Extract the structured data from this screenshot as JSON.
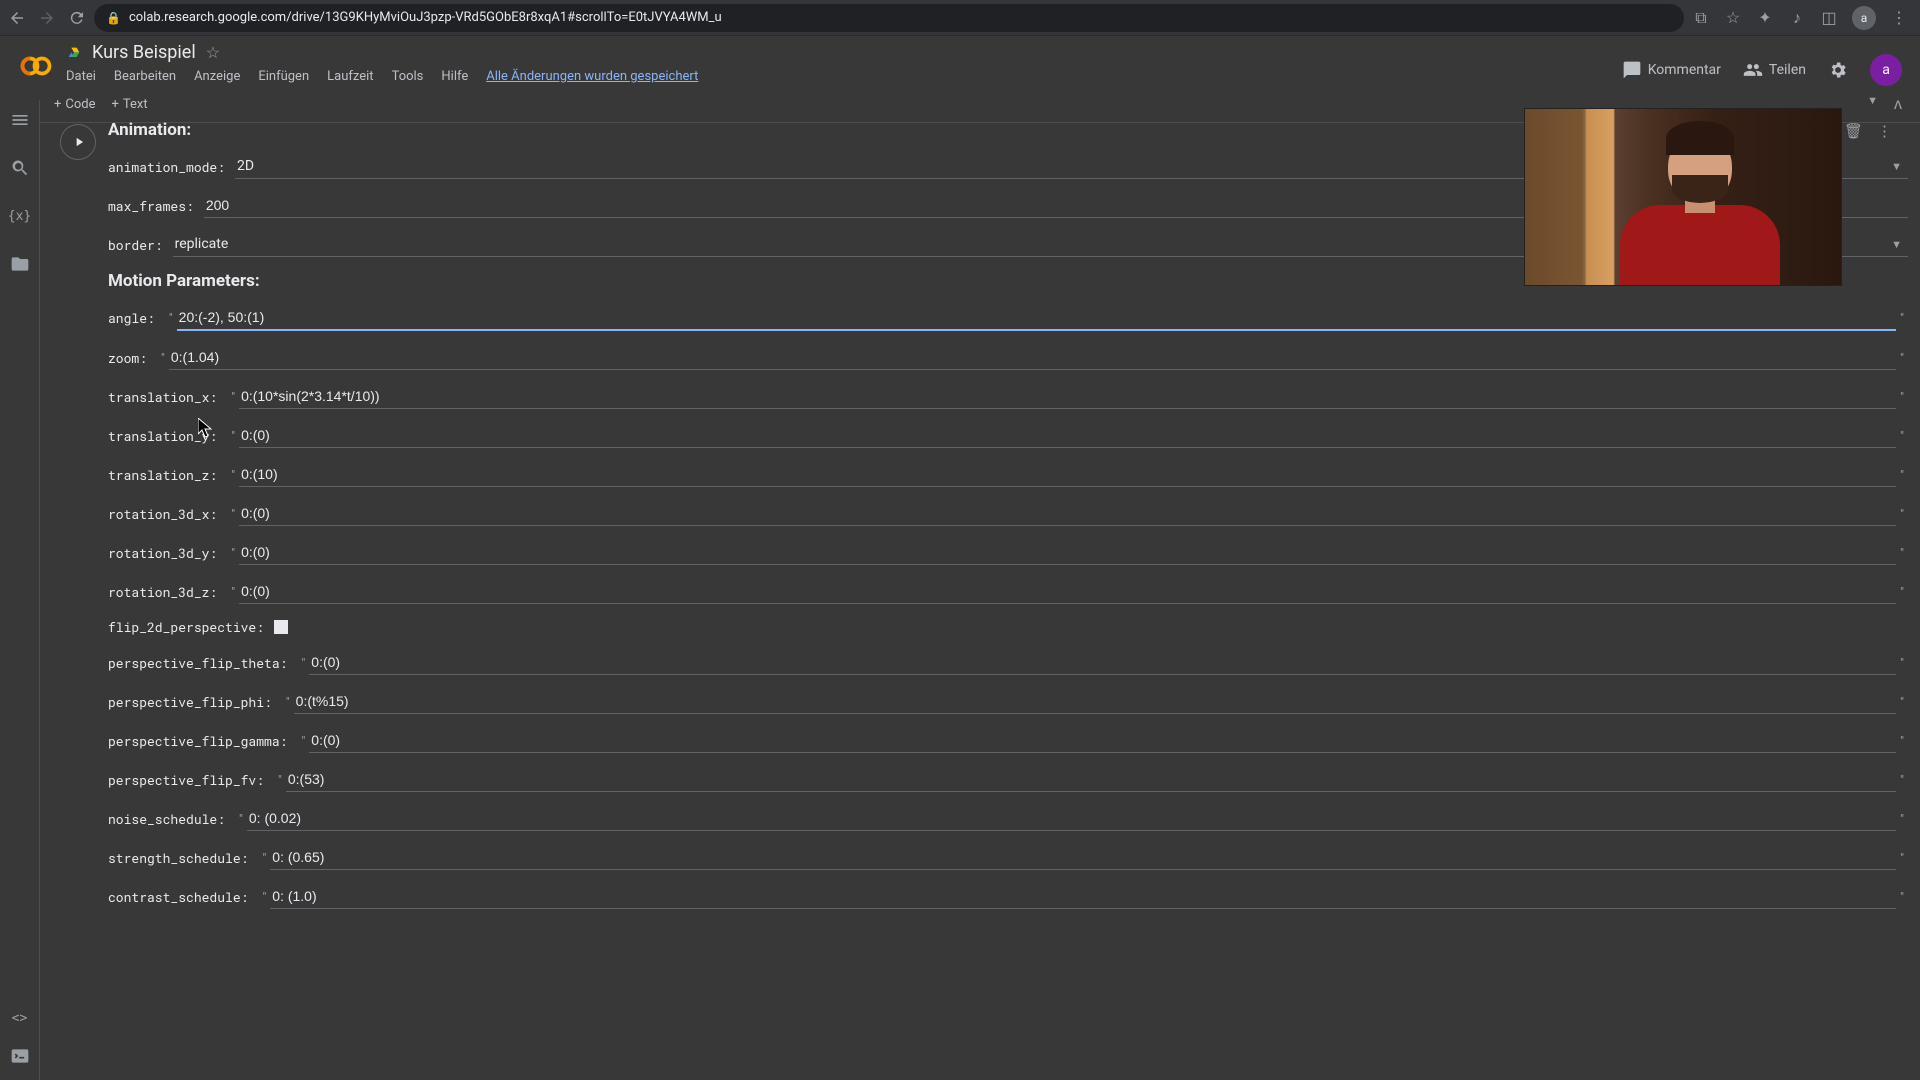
{
  "browser": {
    "url": "colab.research.google.com/drive/13G9KHyMviOuJ3pzp-VRd5GObE8r8xqA1#scrollTo=E0tJVYA4WM_u",
    "avatar_letter": "a"
  },
  "header": {
    "title": "Kurs Beispiel",
    "menu": [
      "Datei",
      "Bearbeiten",
      "Anzeige",
      "Einfügen",
      "Laufzeit",
      "Tools",
      "Hilfe"
    ],
    "save_status": "Alle Änderungen wurden gespeichert",
    "comment_label": "Kommentar",
    "share_label": "Teilen",
    "avatar_letter": "a"
  },
  "toolbar": {
    "code_label": "Code",
    "text_label": "Text"
  },
  "cell": {
    "sections": {
      "animation": "Animation:",
      "motion": "Motion Parameters:"
    },
    "fields": {
      "animation_mode": {
        "label": "animation_mode:",
        "value": "2D",
        "type": "select"
      },
      "max_frames": {
        "label": "max_frames:",
        "value": "200",
        "type": "text_plain"
      },
      "border": {
        "label": "border:",
        "value": "replicate",
        "type": "select"
      },
      "angle": {
        "label": "angle:",
        "value": "20:(-2), 50:(1)",
        "type": "text",
        "active": true
      },
      "zoom": {
        "label": "zoom:",
        "value": "0:(1.04)",
        "type": "text"
      },
      "translation_x": {
        "label": "translation_x:",
        "value": "0:(10*sin(2*3.14*t/10))",
        "type": "text"
      },
      "translation_y": {
        "label": "translation_y:",
        "value": "0:(0)",
        "type": "text"
      },
      "translation_z": {
        "label": "translation_z:",
        "value": "0:(10)",
        "type": "text"
      },
      "rotation_3d_x": {
        "label": "rotation_3d_x:",
        "value": "0:(0)",
        "type": "text"
      },
      "rotation_3d_y": {
        "label": "rotation_3d_y:",
        "value": "0:(0)",
        "type": "text"
      },
      "rotation_3d_z": {
        "label": "rotation_3d_z:",
        "value": "0:(0)",
        "type": "text"
      },
      "flip_2d_perspective": {
        "label": "flip_2d_perspective:",
        "value": false,
        "type": "checkbox"
      },
      "perspective_flip_theta": {
        "label": "perspective_flip_theta:",
        "value": "0:(0)",
        "type": "text"
      },
      "perspective_flip_phi": {
        "label": "perspective_flip_phi:",
        "value": "0:(t%15)",
        "type": "text"
      },
      "perspective_flip_gamma": {
        "label": "perspective_flip_gamma:",
        "value": "0:(0)",
        "type": "text"
      },
      "perspective_flip_fv": {
        "label": "perspective_flip_fv:",
        "value": "0:(53)",
        "type": "text"
      },
      "noise_schedule": {
        "label": "noise_schedule:",
        "value": "0: (0.02)",
        "type": "text"
      },
      "strength_schedule": {
        "label": "strength_schedule:",
        "value": "0: (0.65)",
        "type": "text"
      },
      "contrast_schedule": {
        "label": "contrast_schedule:",
        "value": "0: (1.0)",
        "type": "text"
      }
    },
    "field_order_animation": [
      "animation_mode",
      "max_frames",
      "border"
    ],
    "field_order_motion": [
      "angle",
      "zoom",
      "translation_x",
      "translation_y",
      "translation_z",
      "rotation_3d_x",
      "rotation_3d_y",
      "rotation_3d_z",
      "flip_2d_perspective",
      "perspective_flip_theta",
      "perspective_flip_phi",
      "perspective_flip_gamma",
      "perspective_flip_fv",
      "noise_schedule",
      "strength_schedule",
      "contrast_schedule"
    ]
  }
}
